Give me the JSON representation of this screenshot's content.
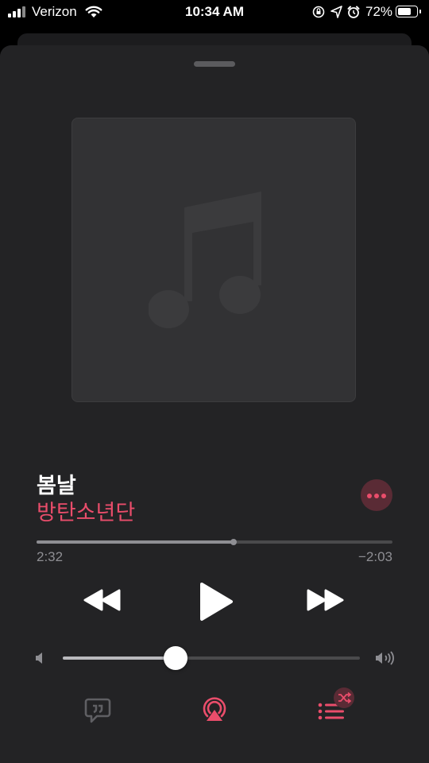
{
  "status_bar": {
    "carrier": "Verizon",
    "time": "10:34 AM",
    "battery_percent": "72%",
    "battery_level": 0.72,
    "icons": [
      "signal-icon",
      "wifi-icon",
      "orientation-lock-icon",
      "location-icon",
      "alarm-icon",
      "battery-icon"
    ]
  },
  "now_playing": {
    "artwork_icon": "music-note-icon",
    "title": "봄날",
    "artist": "방탄소년단",
    "elapsed": "2:32",
    "remaining": "−2:03",
    "progress": 0.553
  },
  "controls": {
    "rewind_icon": "rewind-icon",
    "play_icon": "play-icon",
    "forward_icon": "fast-forward-icon",
    "volume_level": 0.38
  },
  "bottom_bar": {
    "lyrics_icon": "lyrics-icon",
    "airplay_icon": "airplay-icon",
    "queue_icon": "queue-icon",
    "shuffle_icon": "shuffle-icon"
  },
  "colors": {
    "accent": "#ea4d6b",
    "sheet_background": "#232325",
    "secondary_text": "#8e8e93"
  }
}
